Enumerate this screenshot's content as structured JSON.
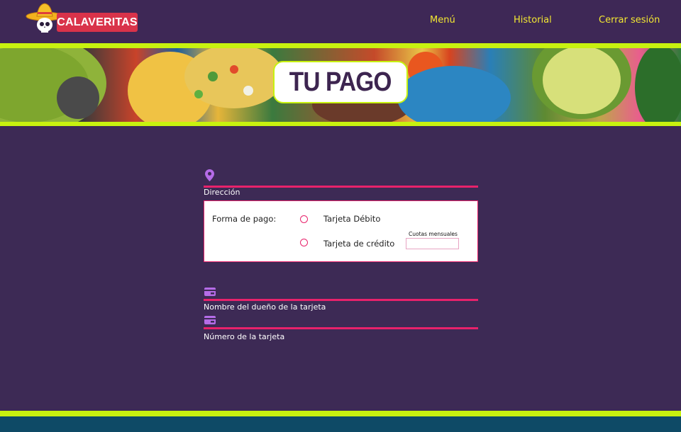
{
  "header": {
    "logo_text": "CALAVERITAS",
    "nav": {
      "menu": "Menú",
      "history": "Historial",
      "logout": "Cerrar sesión"
    }
  },
  "banner": {
    "title": "TU PAGO"
  },
  "form": {
    "address": {
      "icon": "location-pin-icon",
      "label": "Dirección"
    },
    "payment": {
      "label": "Forma de pago:",
      "options": [
        {
          "label": "Tarjeta Débito",
          "selected": false
        },
        {
          "label": "Tarjeta de crédito",
          "selected": false
        }
      ],
      "installments_label": "Cuotas mensuales",
      "installments_value": ""
    },
    "card_owner": {
      "icon": "credit-card-icon",
      "label": "Nombre del dueño de la tarjeta"
    },
    "card_number": {
      "icon": "credit-card-icon",
      "label": "Número de la tarjeta"
    }
  },
  "colors": {
    "background": "#3d2a55",
    "accent_lime": "#c8f20f",
    "accent_pink": "#e8226b",
    "nav_text": "#f3e832",
    "footer": "#0e4a66",
    "icon": "#b56ce8"
  }
}
